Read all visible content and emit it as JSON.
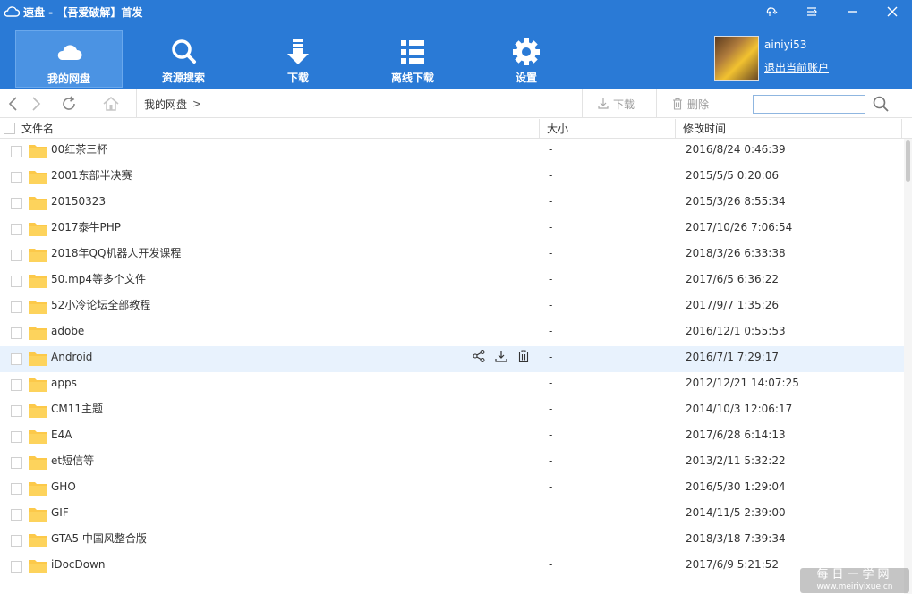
{
  "titlebar": {
    "title": "速盘 - 【吾爱破解】首发"
  },
  "nav": [
    {
      "label": "我的网盘",
      "icon": "cloud-icon"
    },
    {
      "label": "资源搜索",
      "icon": "search-icon"
    },
    {
      "label": "下载",
      "icon": "download-icon"
    },
    {
      "label": "离线下载",
      "icon": "list-icon"
    },
    {
      "label": "设置",
      "icon": "gear-icon"
    }
  ],
  "user": {
    "name": "ainiyi53",
    "logout": "退出当前账户"
  },
  "toolbar": {
    "breadcrumb": "我的网盘",
    "breadcrumb_sep": ">",
    "download_label": "下载",
    "delete_label": "删除",
    "search_value": ""
  },
  "columns": {
    "name": "文件名",
    "size": "大小",
    "time": "修改时间"
  },
  "files": [
    {
      "name": "00红茶三杯",
      "size": "-",
      "time": "2016/8/24 0:46:39"
    },
    {
      "name": "2001东部半决赛",
      "size": "-",
      "time": "2015/5/5 0:20:06"
    },
    {
      "name": "20150323",
      "size": "-",
      "time": "2015/3/26 8:55:34"
    },
    {
      "name": "2017泰牛PHP",
      "size": "-",
      "time": "2017/10/26 7:06:54"
    },
    {
      "name": "2018年QQ机器人开发课程",
      "size": "-",
      "time": "2018/3/26 6:33:38"
    },
    {
      "name": "50.mp4等多个文件",
      "size": "-",
      "time": "2017/6/5 6:36:22"
    },
    {
      "name": "52小冷论坛全部教程",
      "size": "-",
      "time": "2017/9/7 1:35:26"
    },
    {
      "name": "adobe",
      "size": "-",
      "time": "2016/12/1 0:55:53"
    },
    {
      "name": "Android",
      "size": "-",
      "time": "2016/7/1 7:29:17"
    },
    {
      "name": "apps",
      "size": "-",
      "time": "2012/12/21 14:07:25"
    },
    {
      "name": "CM11主题",
      "size": "-",
      "time": "2014/10/3 12:06:17"
    },
    {
      "name": "E4A",
      "size": "-",
      "time": "2017/6/28 6:14:13"
    },
    {
      "name": "et短信等",
      "size": "-",
      "time": "2013/2/11 5:32:22"
    },
    {
      "name": "GHO",
      "size": "-",
      "time": "2016/5/30 1:29:04"
    },
    {
      "name": "GIF",
      "size": "-",
      "time": "2014/11/5 2:39:00"
    },
    {
      "name": "GTA5 中国风整合版",
      "size": "-",
      "time": "2018/3/18 7:39:34"
    },
    {
      "name": "iDocDown",
      "size": "-",
      "time": "2017/6/9 5:21:52"
    }
  ],
  "watermark": {
    "big": "每日一学网",
    "small": "www.meiriyixue.cn"
  },
  "colors": {
    "brand": "#2a7ad6",
    "folder": "#fcc94a",
    "hover_row": "#e8f2fd"
  }
}
